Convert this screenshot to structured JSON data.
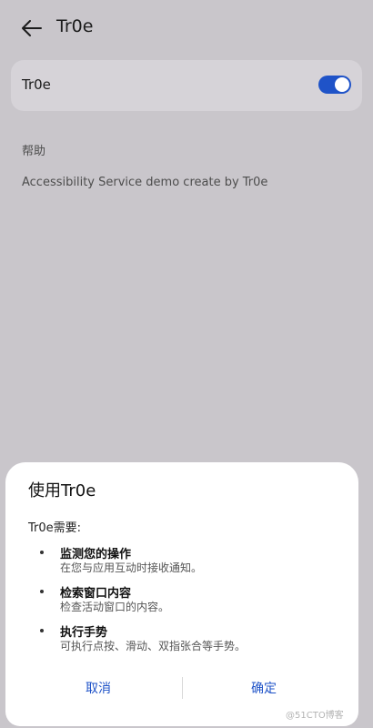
{
  "header": {
    "title": "Tr0e",
    "back_icon": "arrow-left-icon"
  },
  "service_card": {
    "label": "Tr0e",
    "toggle_on": true,
    "toggle_color": "#1f53c8"
  },
  "help": {
    "heading": "帮助",
    "text": "Accessibility Service demo create by Tr0e"
  },
  "dialog": {
    "title": "使用Tr0e",
    "subtitle": "Tr0e需要:",
    "permissions": [
      {
        "title": "监测您的操作",
        "desc": "在您与应用互动时接收通知。"
      },
      {
        "title": "检索窗口内容",
        "desc": "检查活动窗口的内容。"
      },
      {
        "title": "执行手势",
        "desc": "可执行点按、滑动、双指张合等手势。"
      }
    ],
    "cancel_label": "取消",
    "ok_label": "确定",
    "button_color": "#1f53c8"
  },
  "watermark": "@51CTO博客"
}
